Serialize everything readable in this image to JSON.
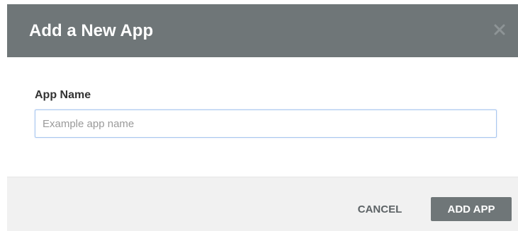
{
  "dialog": {
    "title": "Add a New App",
    "close_icon": "close-icon"
  },
  "form": {
    "app_name_label": "App Name",
    "app_name_value": "",
    "app_name_placeholder": "Example app name"
  },
  "footer": {
    "cancel_label": "CANCEL",
    "submit_label": "ADD APP"
  },
  "colors": {
    "header_bg": "#6f7678",
    "primary_button_bg": "#6f7678",
    "footer_bg": "#f1f1f1",
    "input_border_focus": "#a8c7ef"
  }
}
